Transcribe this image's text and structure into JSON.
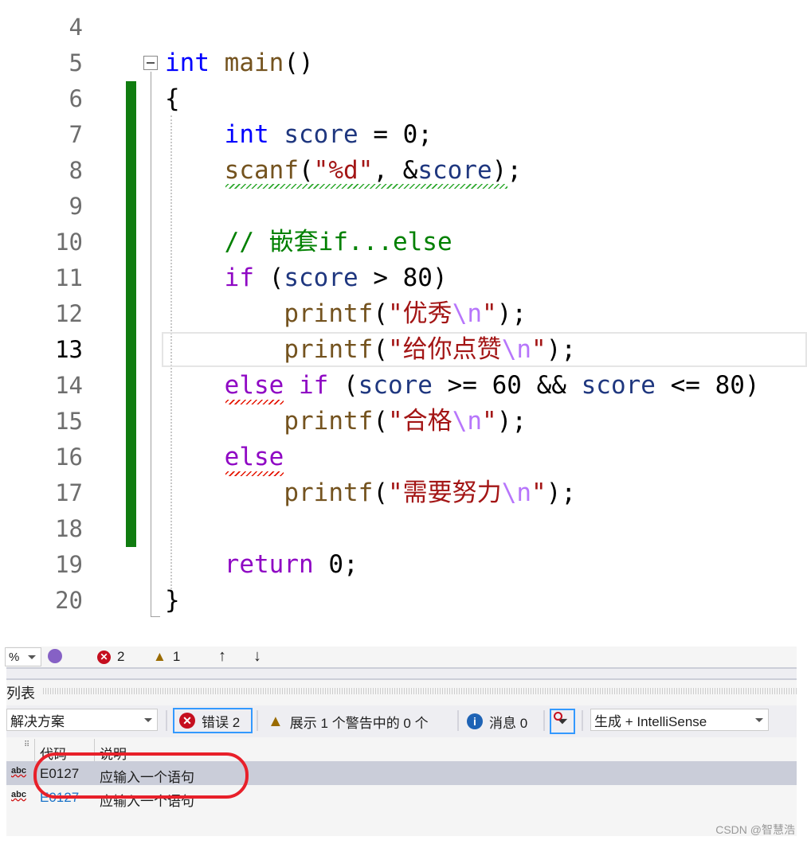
{
  "editor": {
    "line_numbers": [
      "4",
      "5",
      "6",
      "7",
      "8",
      "9",
      "10",
      "11",
      "12",
      "13",
      "14",
      "15",
      "16",
      "17",
      "18",
      "19",
      "20"
    ],
    "current_line": "13",
    "lines": {
      "l5": [
        "int",
        " main",
        "()"
      ],
      "l6": "{",
      "l7": [
        "int",
        " score",
        " = 0;"
      ],
      "l8": [
        "scanf",
        "(",
        "\"%d\"",
        ", &",
        "score",
        ");"
      ],
      "l10": "// 嵌套if...else",
      "l11": [
        "if",
        " (",
        "score",
        " > 80)"
      ],
      "l12": [
        "printf",
        "(",
        "\"优秀",
        "\\n",
        "\"",
        ");"
      ],
      "l13": [
        "printf",
        "(",
        "\"给你点赞",
        "\\n",
        "\"",
        ");"
      ],
      "l14": [
        "else",
        " if",
        " (",
        "score",
        " >= 60 && ",
        "score",
        " <= 80)"
      ],
      "l15": [
        "printf",
        "(",
        "\"合格",
        "\\n",
        "\"",
        ");"
      ],
      "l16": "else",
      "l17": [
        "printf",
        "(",
        "\"需要努力",
        "\\n",
        "\"",
        ");"
      ],
      "l19": [
        "return",
        " 0;"
      ],
      "l20": "}"
    }
  },
  "statusbar": {
    "zoom": "%",
    "errors": "2",
    "warnings": "1"
  },
  "error_list": {
    "title": "列表",
    "scope": "解决方案",
    "errors_button": "错误 2",
    "warnings_button": "展示 1 个警告中的 0 个",
    "messages_button": "消息 0",
    "source": "生成 + IntelliSense",
    "columns": [
      "代码",
      "说明"
    ],
    "rows": [
      {
        "code": "E0127",
        "desc": "应输入一个语句"
      },
      {
        "code": "E0127",
        "desc": "应输入一个语句"
      }
    ]
  },
  "watermark": "CSDN @智慧浩",
  "colors": {
    "green_bar": "#107c10",
    "selected_row": "#cacdd9",
    "annotation": "#e8202a"
  }
}
